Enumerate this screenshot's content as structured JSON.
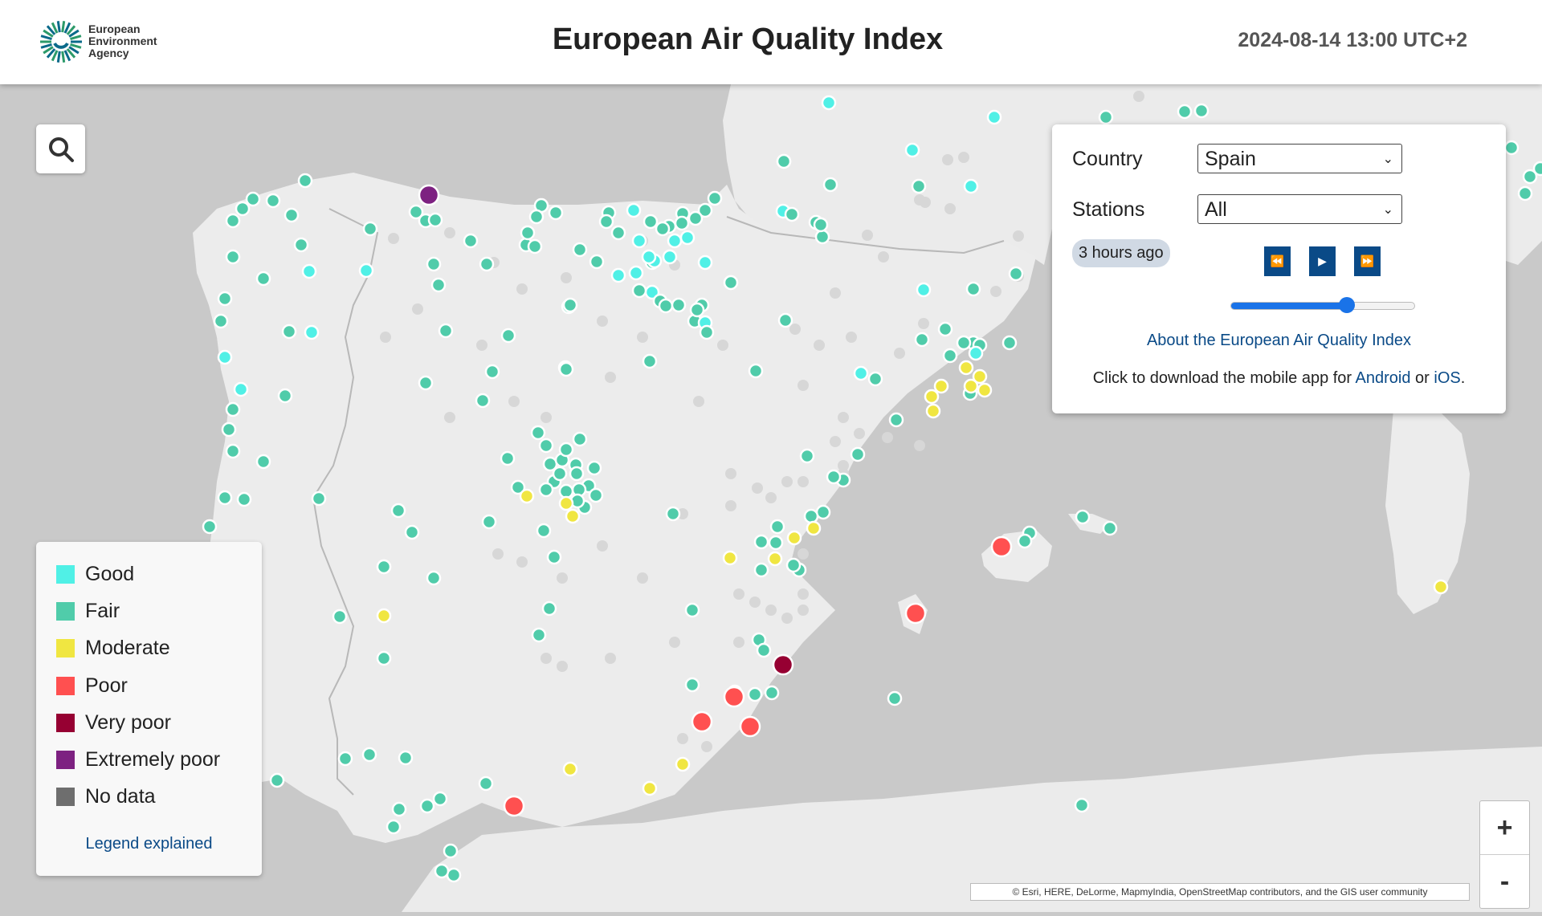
{
  "header": {
    "logo_lines": [
      "European",
      "Environment",
      "Agency"
    ],
    "title": "European Air Quality Index",
    "datetime": "2024-08-14 13:00 UTC+2"
  },
  "colors": {
    "good": "#50f0e6",
    "fair": "#50ccaa",
    "moderate": "#f0e641",
    "poor": "#ff5050",
    "very_poor": "#960032",
    "extremely_poor": "#7d2181",
    "no_data": "#6e6e6e",
    "accent": "#0a4a87"
  },
  "search": {
    "icon": "search-icon"
  },
  "panel": {
    "country_label": "Country",
    "country_value": "Spain",
    "stations_label": "Stations",
    "stations_value": "All",
    "time_badge": "3 hours ago",
    "slider_fraction": 0.63,
    "about_link": "About the European Air Quality Index",
    "app_text_before": "Click to download the mobile app for ",
    "app_android": "Android",
    "app_or": " or ",
    "app_ios": "iOS",
    "app_after": "."
  },
  "legend": {
    "items": [
      {
        "label": "Good",
        "color": "#50f0e6"
      },
      {
        "label": "Fair",
        "color": "#50ccaa"
      },
      {
        "label": "Moderate",
        "color": "#f0e641"
      },
      {
        "label": "Poor",
        "color": "#ff5050"
      },
      {
        "label": "Very poor",
        "color": "#960032"
      },
      {
        "label": "Extremely poor",
        "color": "#7d2181"
      },
      {
        "label": "No data",
        "color": "#6e6e6e"
      }
    ],
    "link": "Legend explained"
  },
  "zoom": {
    "in_label": "+",
    "out_label": "-"
  },
  "attribution": "© Esri, HERE, DeLorme, MapmyIndia, OpenStreetMap contributors, and the GIS user community"
}
